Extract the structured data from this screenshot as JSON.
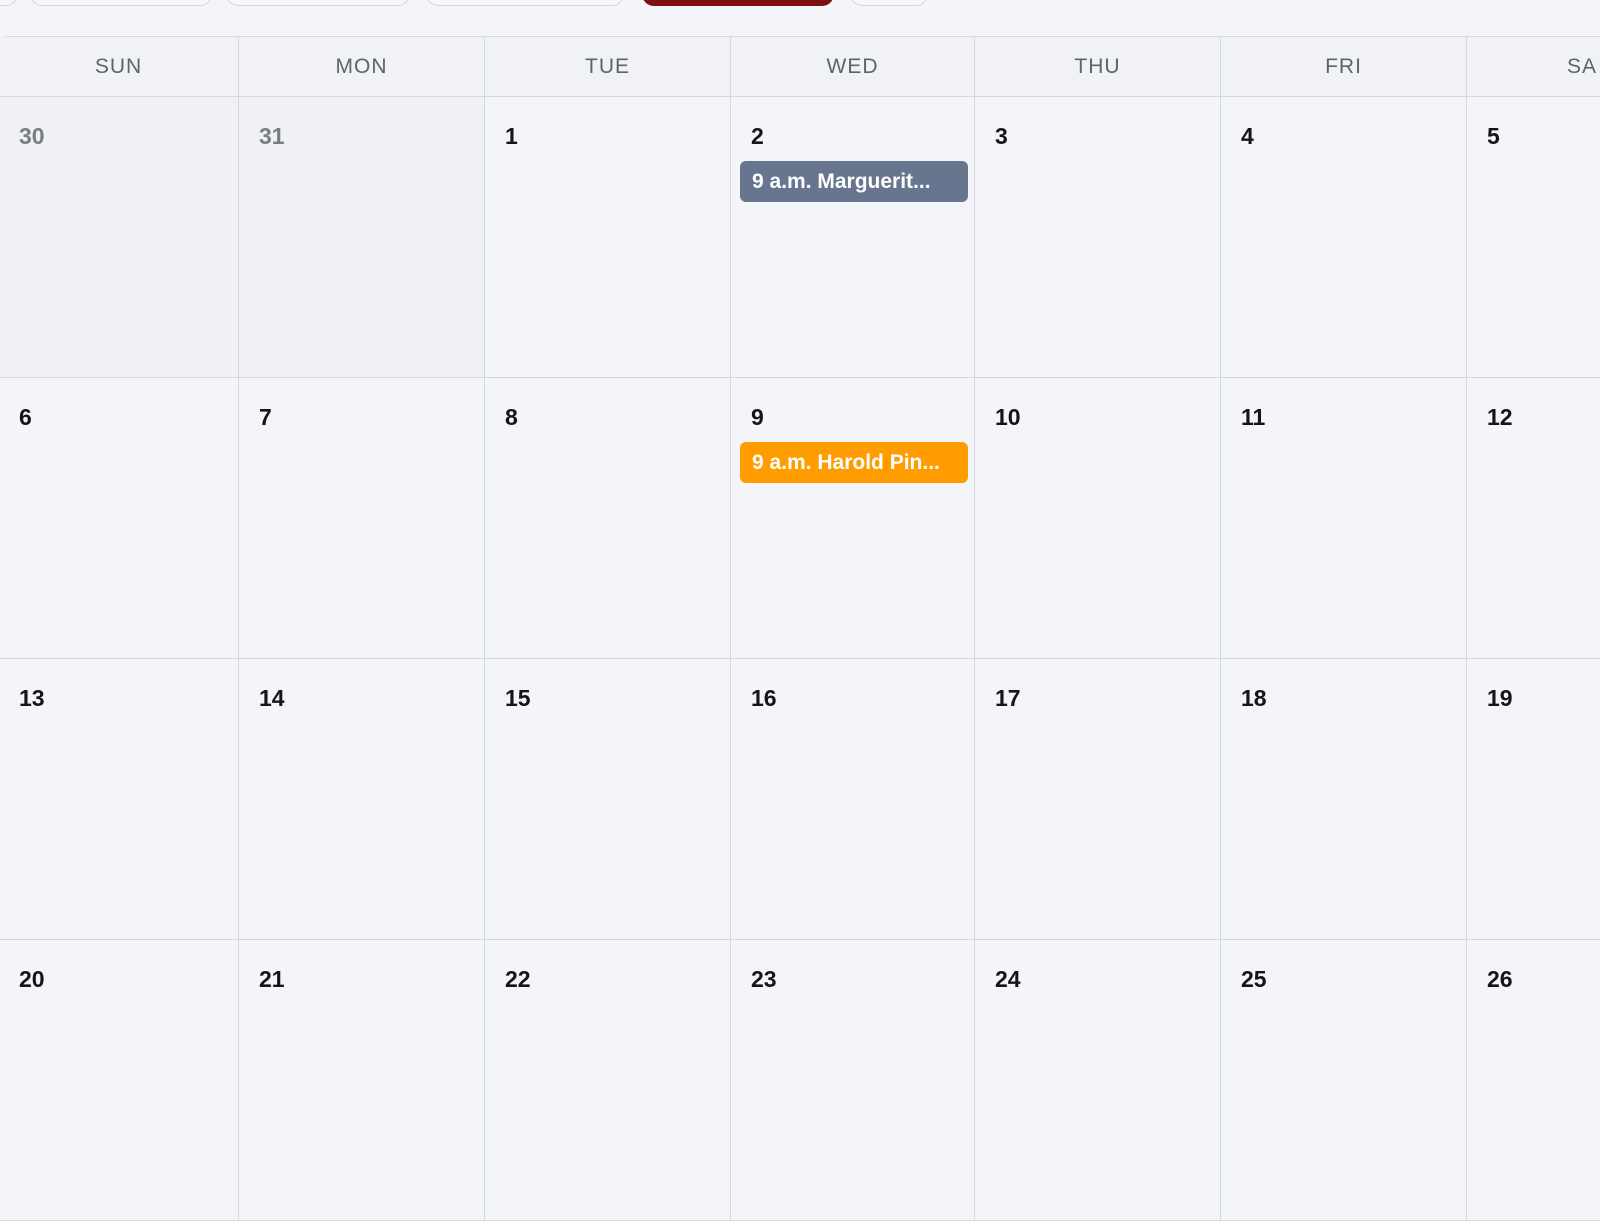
{
  "weekdays": [
    "SUN",
    "MON",
    "TUE",
    "WED",
    "THU",
    "FRI",
    "SA"
  ],
  "weeks": [
    [
      {
        "day": "30",
        "outside": true
      },
      {
        "day": "31",
        "outside": true
      },
      {
        "day": "1"
      },
      {
        "day": "2",
        "event": {
          "label": "9 a.m. Marguerit...",
          "color": "#67758f"
        }
      },
      {
        "day": "3"
      },
      {
        "day": "4"
      },
      {
        "day": "5"
      }
    ],
    [
      {
        "day": "6"
      },
      {
        "day": "7"
      },
      {
        "day": "8"
      },
      {
        "day": "9",
        "event": {
          "label": "9 a.m. Harold Pin...",
          "color": "#ff9d00"
        }
      },
      {
        "day": "10"
      },
      {
        "day": "11"
      },
      {
        "day": "12"
      }
    ],
    [
      {
        "day": "13"
      },
      {
        "day": "14"
      },
      {
        "day": "15"
      },
      {
        "day": "16"
      },
      {
        "day": "17"
      },
      {
        "day": "18"
      },
      {
        "day": "19"
      }
    ],
    [
      {
        "day": "20"
      },
      {
        "day": "21"
      },
      {
        "day": "22"
      },
      {
        "day": "23"
      },
      {
        "day": "24"
      },
      {
        "day": "25"
      },
      {
        "day": "26"
      }
    ]
  ],
  "colors": {
    "accent": "#7d1111",
    "border": "#d4d7de"
  }
}
